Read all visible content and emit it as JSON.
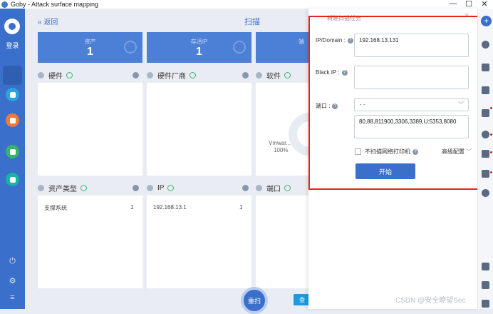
{
  "window": {
    "title": "Goby - Attack surface mapping",
    "controls": [
      "—",
      "☐",
      "✕"
    ]
  },
  "leftbar": {
    "login_label": "登录",
    "bottom_icons": [
      "power-icon",
      "settings-icon",
      "menu-icon"
    ],
    "icon_colors": [
      "#2aa3e0",
      "#f07a3a",
      "#35b56a",
      "#17b3a3"
    ]
  },
  "header": {
    "back_label": "返回",
    "title": "扫描"
  },
  "stats": [
    {
      "label": "资产",
      "value": "1"
    },
    {
      "label": "存活IP",
      "value": "1"
    },
    {
      "label": "端",
      "value": ""
    }
  ],
  "sections": {
    "hardware": "硬件",
    "vendor": "硬件厂商",
    "software": "软件",
    "asset_type": "资产类型",
    "ip": "IP",
    "port": "端口"
  },
  "asset_type_rows": [
    {
      "name": "支撑系统",
      "count": "1"
    }
  ],
  "ip_rows": [
    {
      "name": "192.168.13.1",
      "count": "1"
    }
  ],
  "software_chart": {
    "label": "Vmwar...",
    "percent": "100%"
  },
  "actions": {
    "scan_label": "重扫",
    "check_label": "查"
  },
  "dialog": {
    "title": "新建扫描任务",
    "ip_label": "IP/Domain :",
    "ip_value": "192.168.13.131",
    "black_ip_label": "Black IP :",
    "black_ip_value": "",
    "port_label": "端口 :",
    "port_select": "- -",
    "port_value": "80,88,811900,3306,3389,U:5353,8080",
    "no_printer_label": "不扫描网络打印机",
    "advanced_label": "高级配置",
    "start_label": "开始"
  },
  "watermark": "CSDN @安全瞭望Sec"
}
